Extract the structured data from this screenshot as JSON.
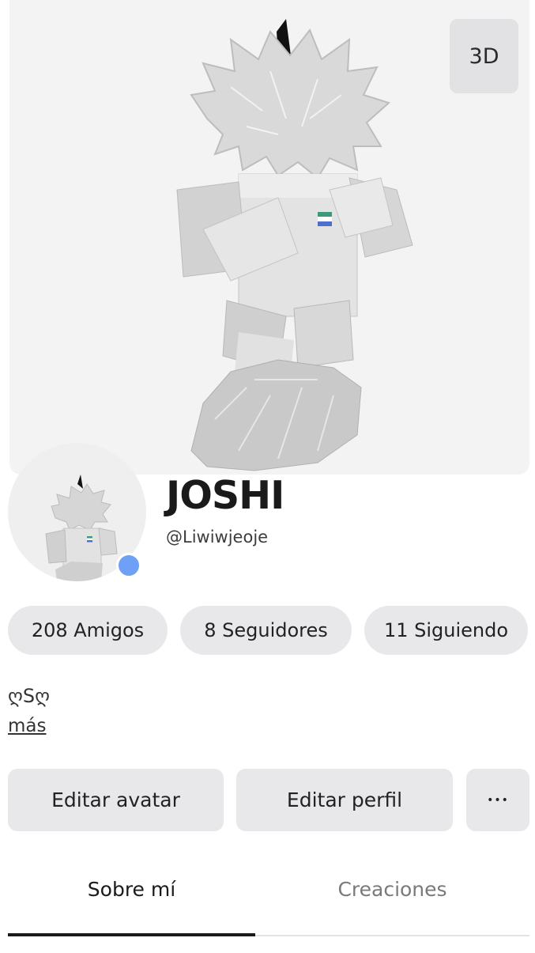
{
  "hero": {
    "view_toggle_label": "3D"
  },
  "profile": {
    "display_name": "JOSHI",
    "username": "@Liwiwjeoje",
    "bio": "ღSღ",
    "more_label": "más"
  },
  "stats": [
    {
      "label": "208 Amigos"
    },
    {
      "label": "8 Seguidores"
    },
    {
      "label": "11 Siguiendo"
    }
  ],
  "actions": {
    "edit_avatar": "Editar avatar",
    "edit_profile": "Editar perfil",
    "more_icon": "ellipsis-icon",
    "more_glyph": "•••"
  },
  "tabs": [
    {
      "label": "Sobre mí",
      "active": true
    },
    {
      "label": "Creaciones",
      "active": false
    }
  ],
  "colors": {
    "presence": "#6ea1f5",
    "pill_bg": "#e8e8ea"
  }
}
